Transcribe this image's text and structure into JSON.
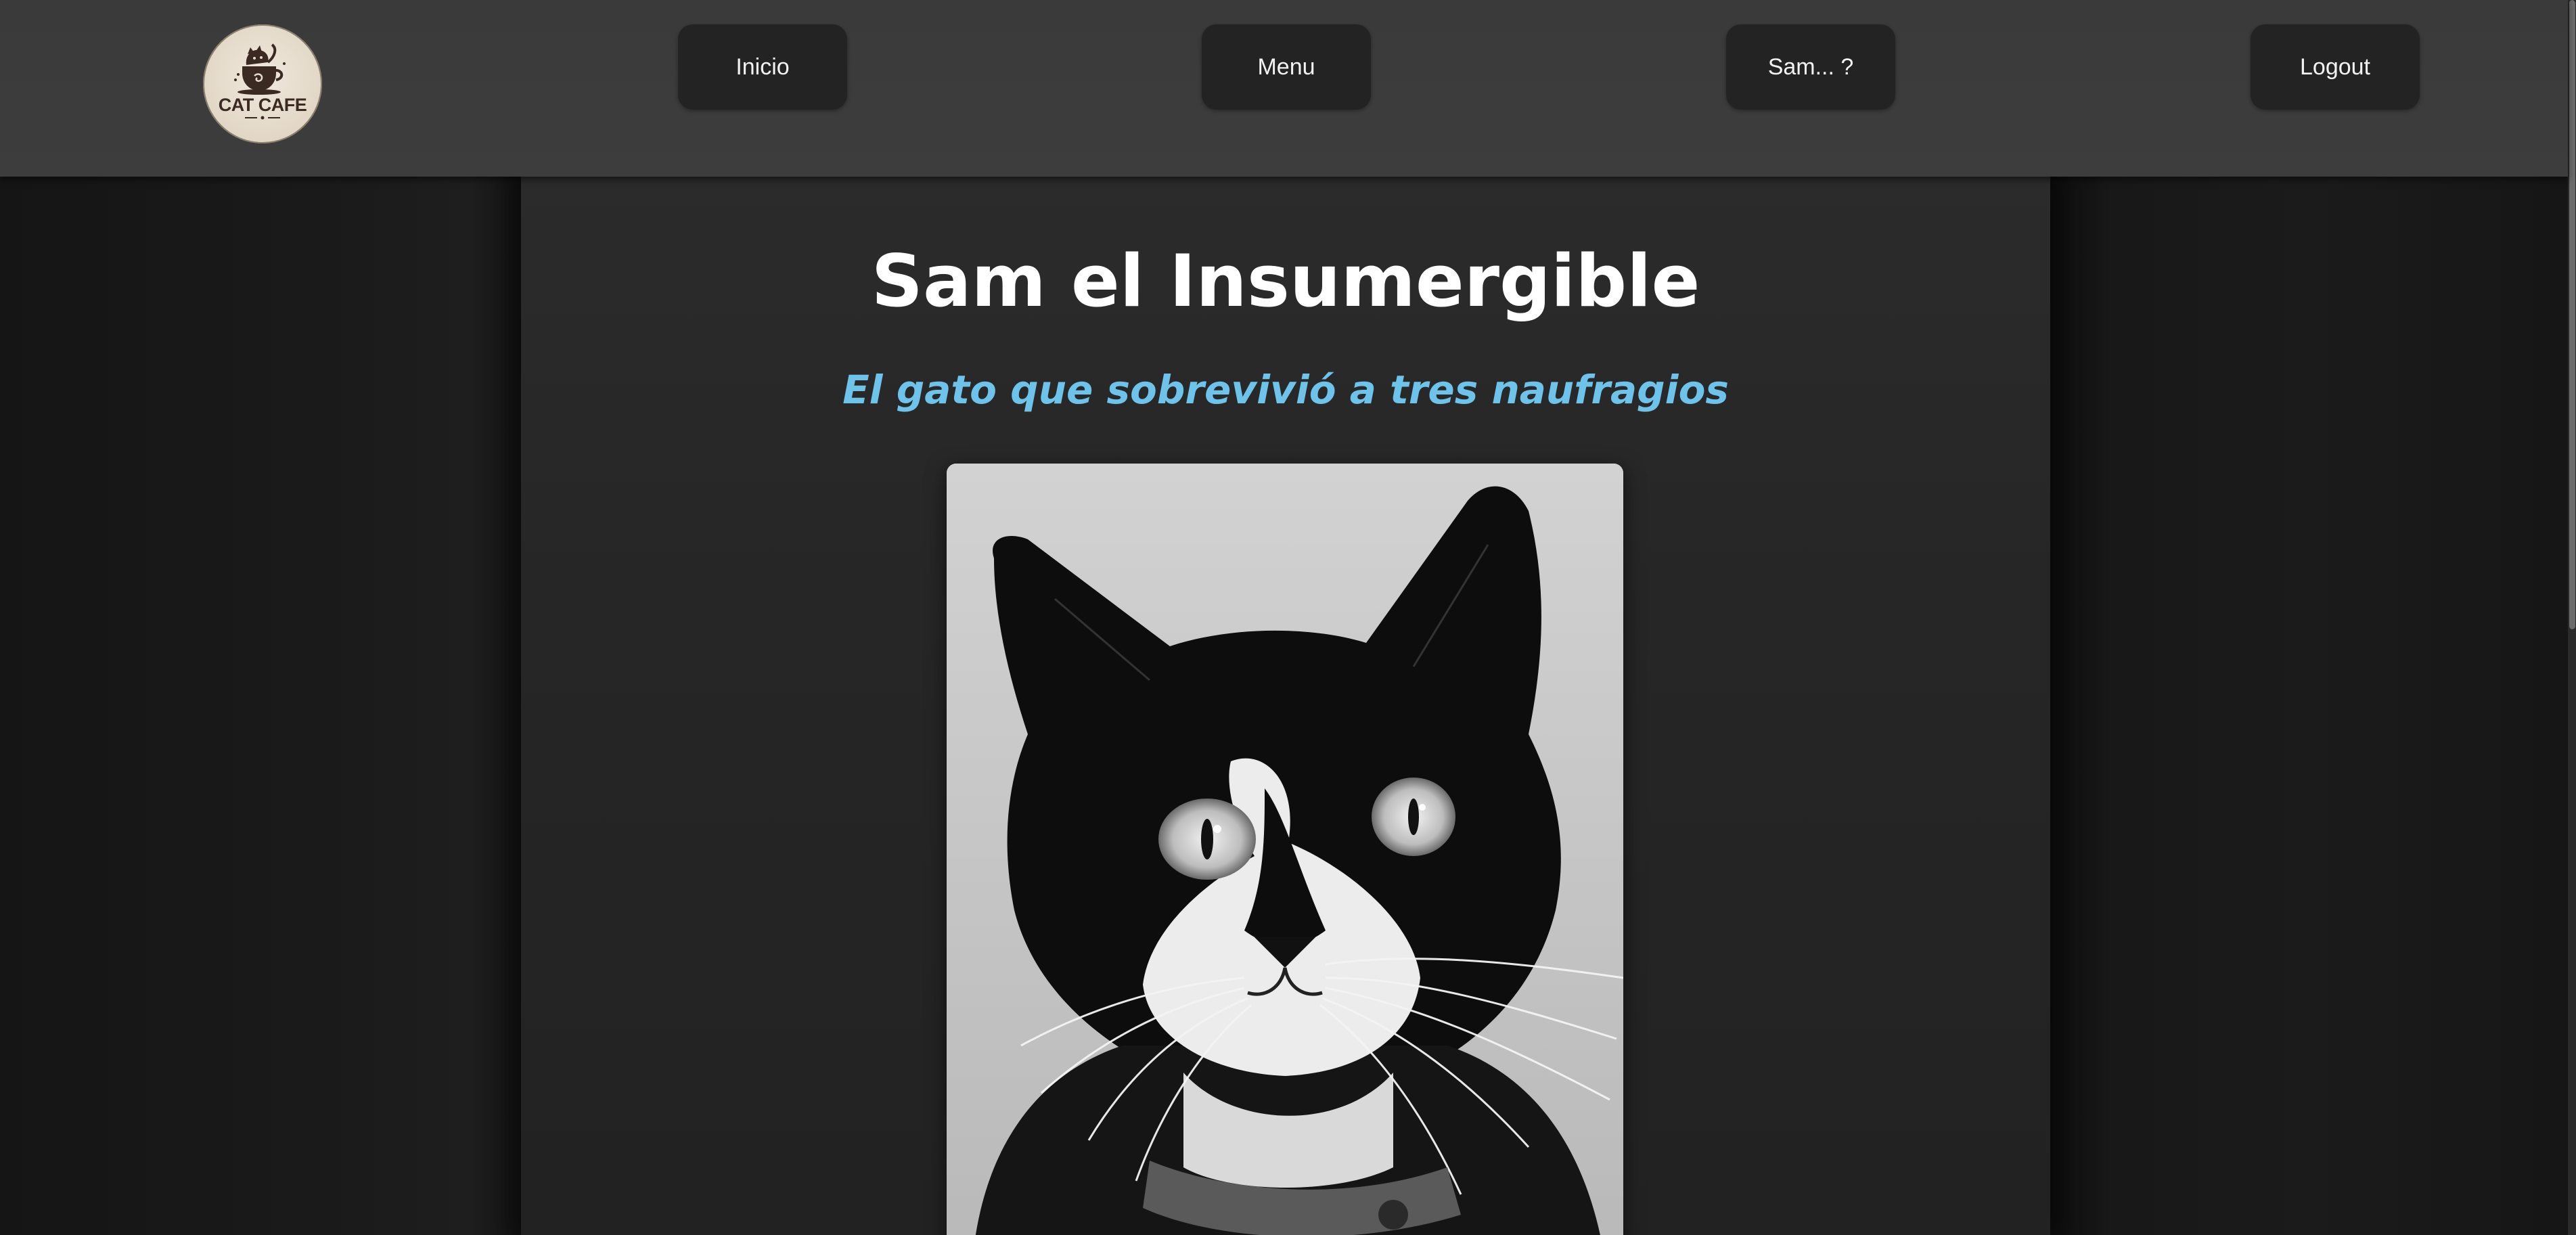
{
  "header": {
    "logo_text": "CAT CAFE",
    "nav": [
      {
        "label": "Inicio"
      },
      {
        "label": "Menu"
      },
      {
        "label": "Sam... ?"
      },
      {
        "label": "Logout"
      }
    ]
  },
  "main": {
    "title": "Sam el Insumergible",
    "subtitle": "El gato que sobrevivió a tres naufragios"
  },
  "colors": {
    "navbar_bg": "#3c3c3c",
    "button_bg": "#232323",
    "subtitle_accent": "#6ec3ea",
    "title_text": "#ffffff"
  }
}
